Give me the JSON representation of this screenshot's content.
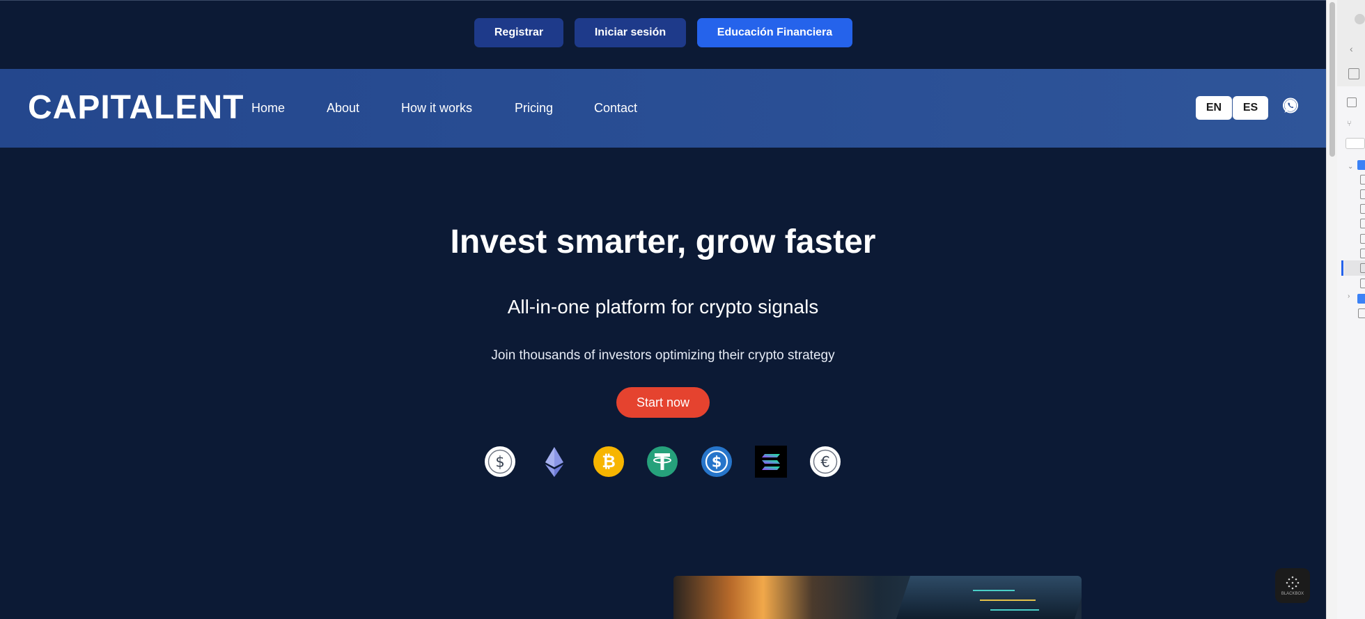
{
  "auth_bar": {
    "register_label": "Registrar",
    "login_label": "Iniciar sesión",
    "education_label": "Educación Financiera"
  },
  "nav": {
    "logo": "CAPITALENT",
    "links": [
      "Home",
      "About",
      "How it works",
      "Pricing",
      "Contact"
    ],
    "lang_en": "EN",
    "lang_es": "ES"
  },
  "hero": {
    "title": "Invest smarter, grow faster",
    "subtitle": "All-in-one platform for crypto signals",
    "description": "Join thousands of investors optimizing their crypto strategy",
    "cta_label": "Start now"
  },
  "coins": [
    "dollar-icon",
    "ethereum-icon",
    "bitcoin-icon",
    "tether-icon",
    "usdc-icon",
    "solana-icon",
    "euro-icon"
  ],
  "widget": {
    "label": "BLACKBOX"
  },
  "colors": {
    "background": "#0c1a35",
    "nav": "#2a4f95",
    "primary_button": "#1e3a8a",
    "accent_button": "#2563eb",
    "cta": "#e5432f"
  }
}
